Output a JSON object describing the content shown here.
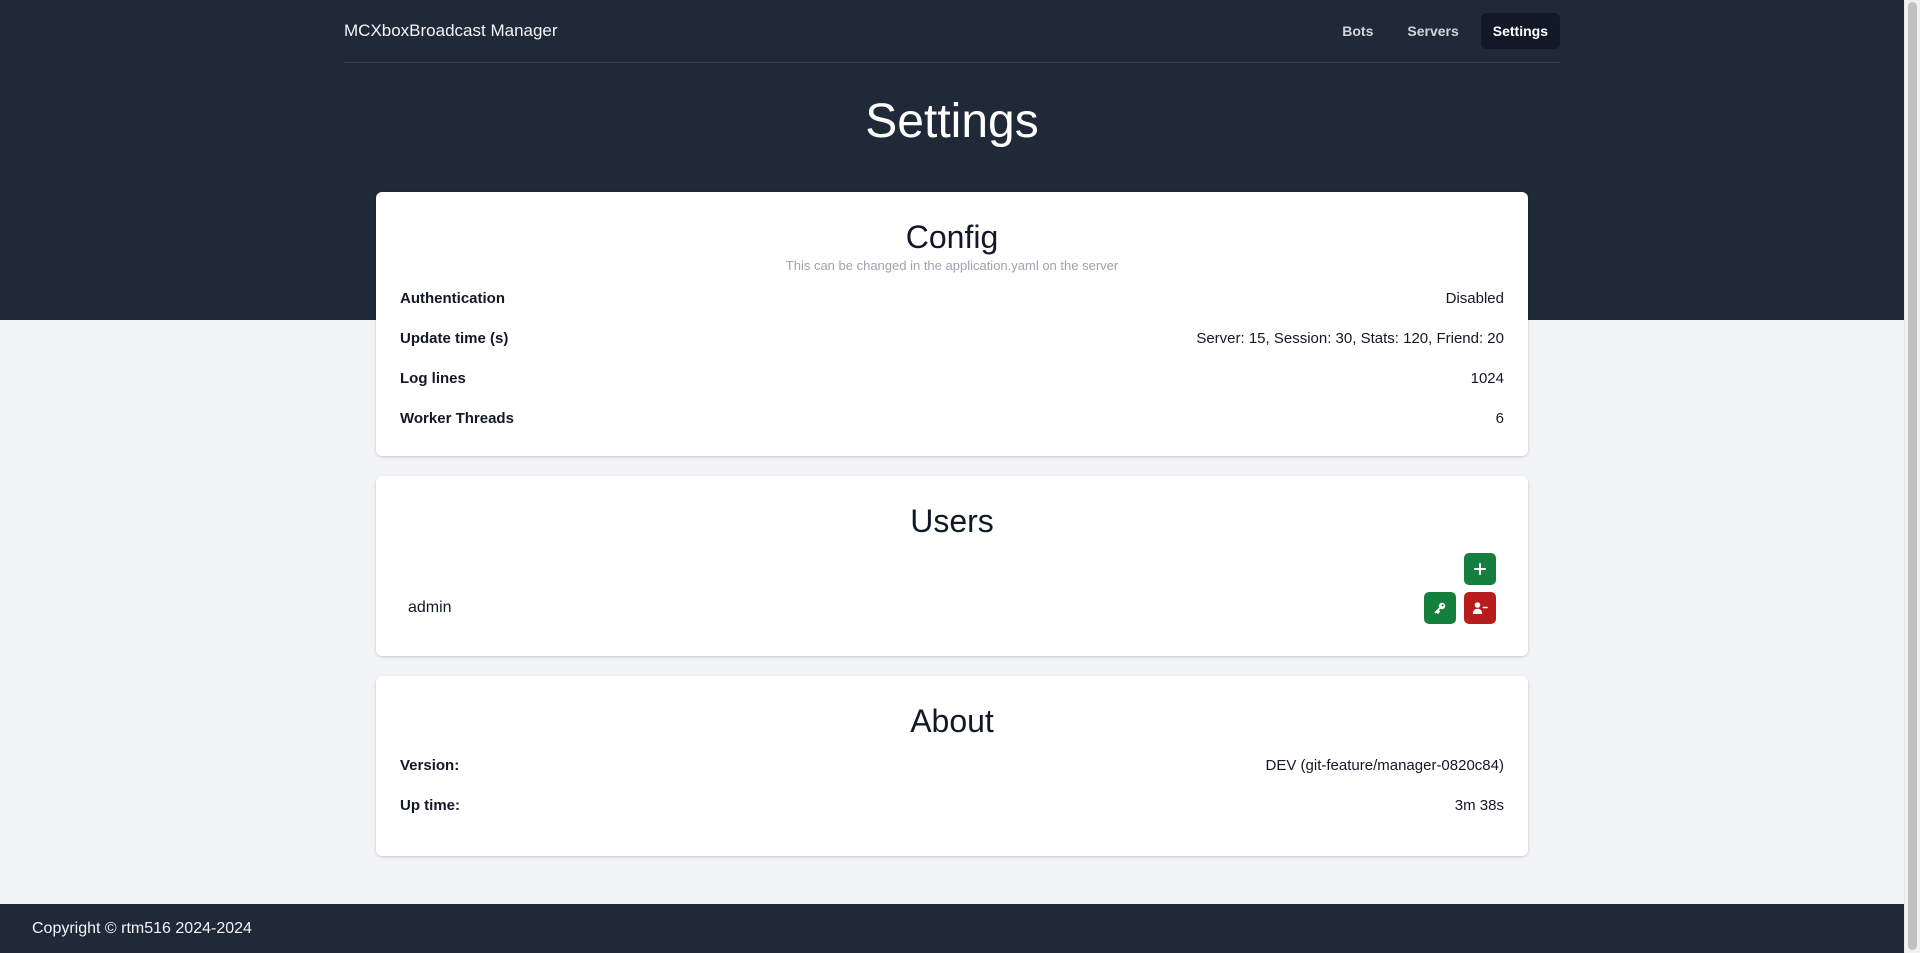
{
  "app": {
    "brand": "MCXboxBroadcast Manager"
  },
  "nav": {
    "bots": "Bots",
    "servers": "Servers",
    "settings": "Settings"
  },
  "page": {
    "title": "Settings"
  },
  "config": {
    "title": "Config",
    "subtitle": "This can be changed in the application.yaml on the server",
    "rows": [
      {
        "key": "Authentication",
        "value": "Disabled"
      },
      {
        "key": "Update time (s)",
        "value": "Server: 15, Session: 30, Stats: 120, Friend: 20"
      },
      {
        "key": "Log lines",
        "value": "1024"
      },
      {
        "key": "Worker Threads",
        "value": "6"
      }
    ]
  },
  "users": {
    "title": "Users",
    "list": [
      {
        "name": "admin"
      }
    ]
  },
  "about": {
    "title": "About",
    "rows": [
      {
        "key": "Version:",
        "value": "DEV (git-feature/manager-0820c84)"
      },
      {
        "key": "Up time:",
        "value": "3m 38s"
      }
    ]
  },
  "footer": {
    "copyright": "Copyright © rtm516 2024-2024"
  },
  "colors": {
    "header_bg": "#1f2937",
    "page_bg": "#f3f4f6",
    "success": "#15803d",
    "danger": "#b91c1c"
  },
  "icons": {
    "add_user": "plus-icon",
    "change_password": "key-icon",
    "remove_user": "user-minus-icon"
  }
}
